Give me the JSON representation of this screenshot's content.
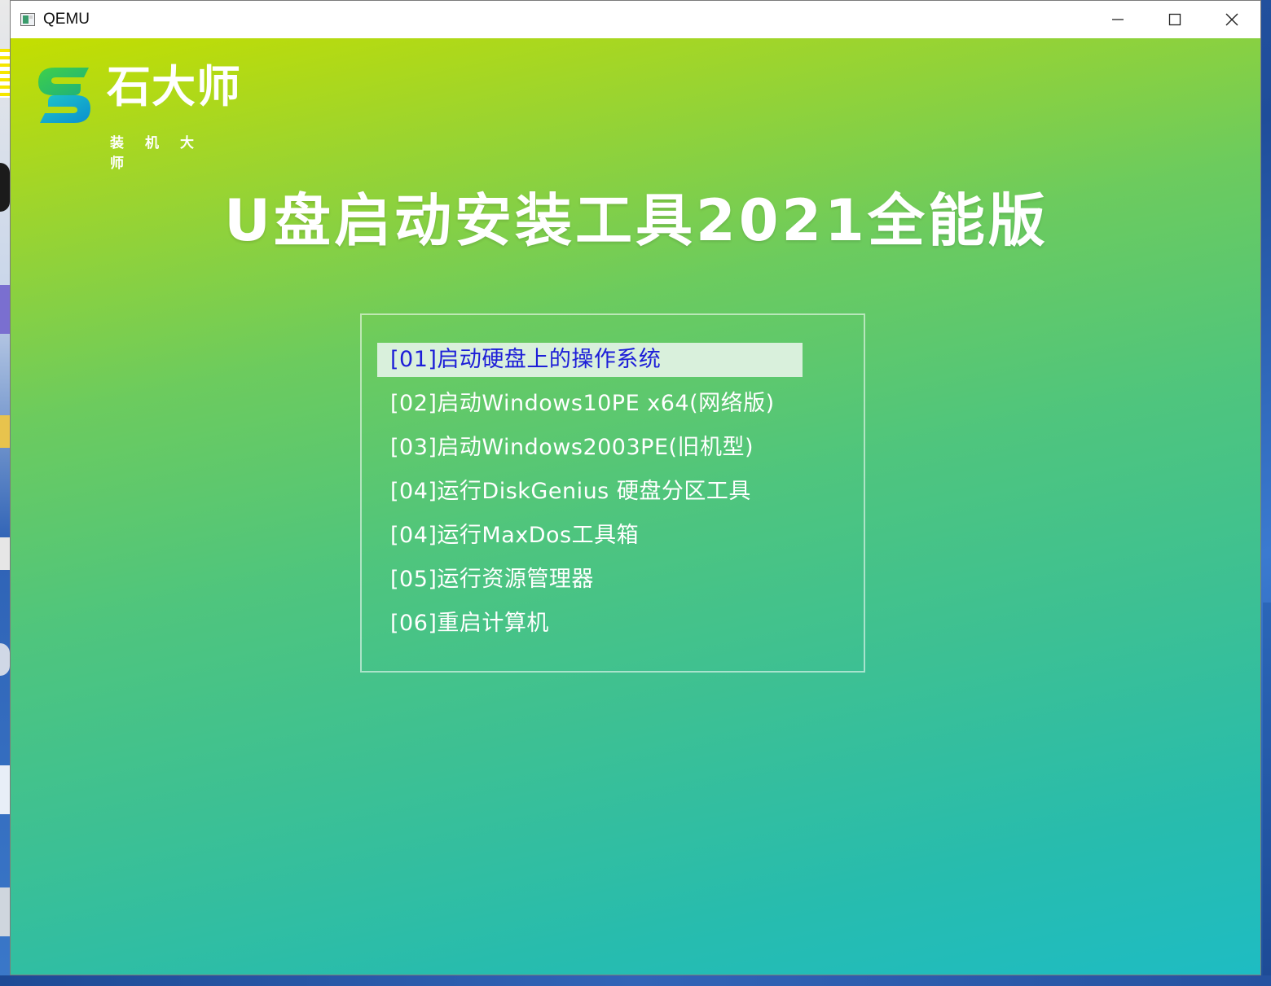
{
  "window": {
    "title": "QEMU",
    "controls": {
      "minimize": "minimize",
      "maximize": "maximize",
      "close": "close"
    }
  },
  "screen": {
    "logo": {
      "brand": "石大师",
      "subtitle": "装机大师"
    },
    "headline": "U盘启动安装工具2021全能版",
    "menu": {
      "selected_index": 0,
      "items": [
        {
          "label": "[01]启动硬盘上的操作系统"
        },
        {
          "label": "[02]启动Windows10PE x64(网络版)"
        },
        {
          "label": "[03]启动Windows2003PE(旧机型)"
        },
        {
          "label": "[04]运行DiskGenius 硬盘分区工具"
        },
        {
          "label": "[04]运行MaxDos工具箱"
        },
        {
          "label": "[05]运行资源管理器"
        },
        {
          "label": "[06]重启计算机"
        }
      ]
    }
  },
  "colors": {
    "selected_bg": "#d9f0dc",
    "selected_text": "#1d1ed8",
    "gradient_top": "#c4de00",
    "gradient_bottom": "#1ebcc3"
  }
}
